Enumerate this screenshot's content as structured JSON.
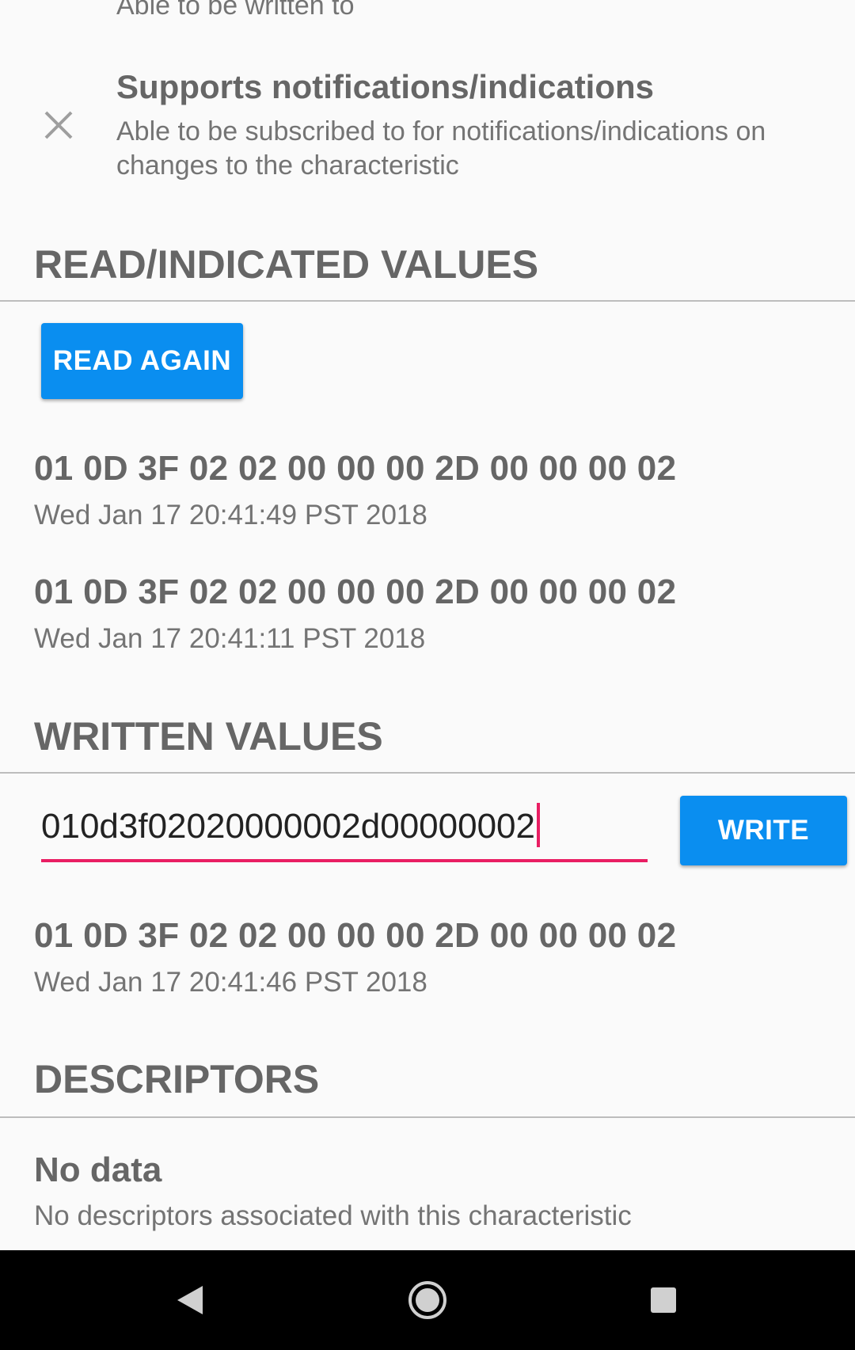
{
  "properties": {
    "partial_desc": "Able to be written to",
    "notify": {
      "title": "Supports notifications/indications",
      "desc": "Able to be subscribed to for notifications/indications on changes to the characteristic"
    }
  },
  "read_section": {
    "header": "READ/INDICATED VALUES",
    "button_label": "READ AGAIN",
    "values": [
      {
        "hex": "01 0D 3F 02 02 00 00 00 2D 00 00 00 02",
        "time": "Wed Jan 17 20:41:49 PST 2018"
      },
      {
        "hex": "01 0D 3F 02 02 00 00 00 2D 00 00 00 02",
        "time": "Wed Jan 17 20:41:11 PST 2018"
      }
    ]
  },
  "written_section": {
    "header": "WRITTEN VALUES",
    "input_value": "010d3f02020000002d00000002",
    "button_label": "WRITE",
    "values": [
      {
        "hex": "01 0D 3F 02 02 00 00 00 2D 00 00 00 02",
        "time": "Wed Jan 17 20:41:46 PST 2018"
      }
    ]
  },
  "descriptors_section": {
    "header": "DESCRIPTORS",
    "empty_title": "No data",
    "empty_desc": "No descriptors associated with this characteristic"
  },
  "icons": {
    "notify_status": "close-icon",
    "nav_back": "back-icon",
    "nav_home": "home-icon",
    "nav_recents": "recents-icon"
  },
  "colors": {
    "accent_button": "#0a8ef0",
    "input_accent": "#e91e63",
    "text_primary": "#666666",
    "background": "#fafafa",
    "navbar": "#000000"
  }
}
